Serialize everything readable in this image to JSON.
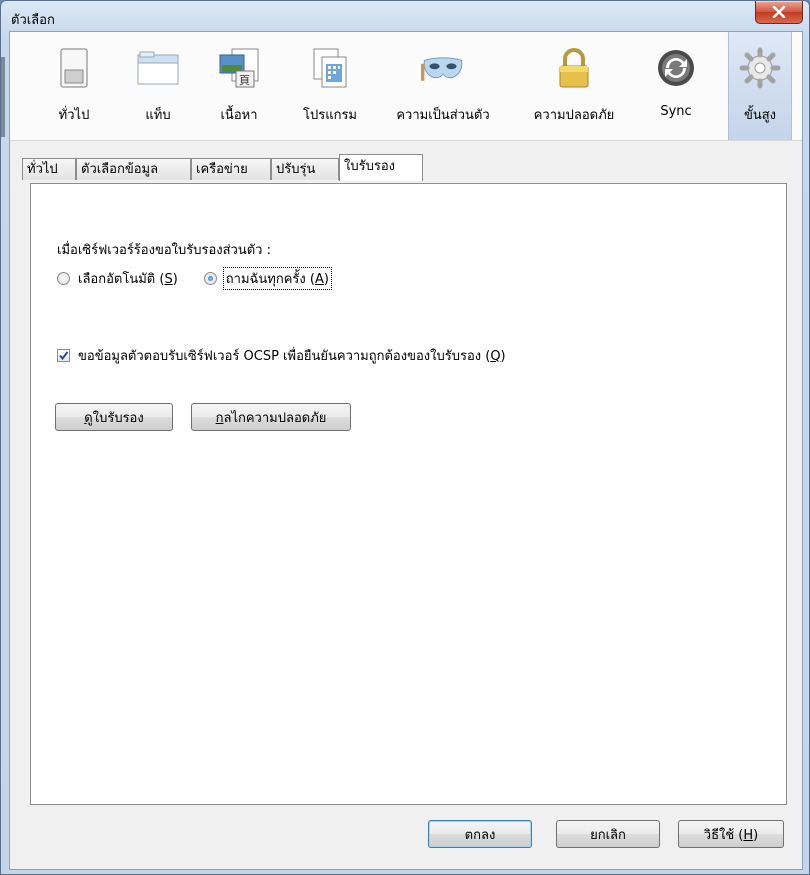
{
  "window": {
    "title": "ตัวเลือก"
  },
  "toolbar": {
    "items": [
      {
        "label": "ทั่วไป",
        "icon": "general-switch-icon"
      },
      {
        "label": "แท็บ",
        "icon": "tabs-window-icon"
      },
      {
        "label": "เนื้อหา",
        "icon": "content-icon"
      },
      {
        "label": "โปรแกรม",
        "icon": "applications-icon"
      },
      {
        "label": "ความเป็นส่วนตัว",
        "icon": "privacy-mask-icon"
      },
      {
        "label": "ความปลอดภัย",
        "icon": "security-lock-icon"
      },
      {
        "label": "Sync",
        "icon": "sync-icon"
      },
      {
        "label": "ขั้นสูง",
        "icon": "advanced-gear-icon"
      }
    ],
    "selected": "ขั้นสูง"
  },
  "tabs": [
    "ทั่วไป",
    "ตัวเลือกข้อมูล",
    "เครือข่าย",
    "ปรับรุ่น",
    "ใบรับรอง"
  ],
  "active_tab": "ใบรับรอง",
  "panel": {
    "question": "เมื่อเซิร์ฟเวอร์ร้องขอใบรับรองส่วนตัว :",
    "radio_auto_text": "เลือกอัตโนมัติ (",
    "radio_auto_key": "S",
    "radio_auto_end": ")",
    "radio_ask_text": "ถามฉันทุกครั้ง (",
    "radio_ask_key": "A",
    "radio_ask_end": ")",
    "radio_selected": "ask",
    "ocsp_text": "ขอข้อมูลตัวตอบรับเซิร์ฟเวอร์ OCSP เพื่อยืนยันความถูกต้องของใบรับรอง (",
    "ocsp_key": "Q",
    "ocsp_end": ")",
    "ocsp_checked": true,
    "view_key": "ด",
    "view_rest": "ูใบรับรอง",
    "devices_key": "ก",
    "devices_rest": "ลไกความปลอดภัย"
  },
  "footer": {
    "ok": "ตกลง",
    "cancel": "ยกเลิก",
    "help_text": "วิธีใช้ (",
    "help_key": "H",
    "help_end": ")"
  },
  "colors": {
    "accent": "#3c7fb1",
    "close": "#c03b24"
  }
}
